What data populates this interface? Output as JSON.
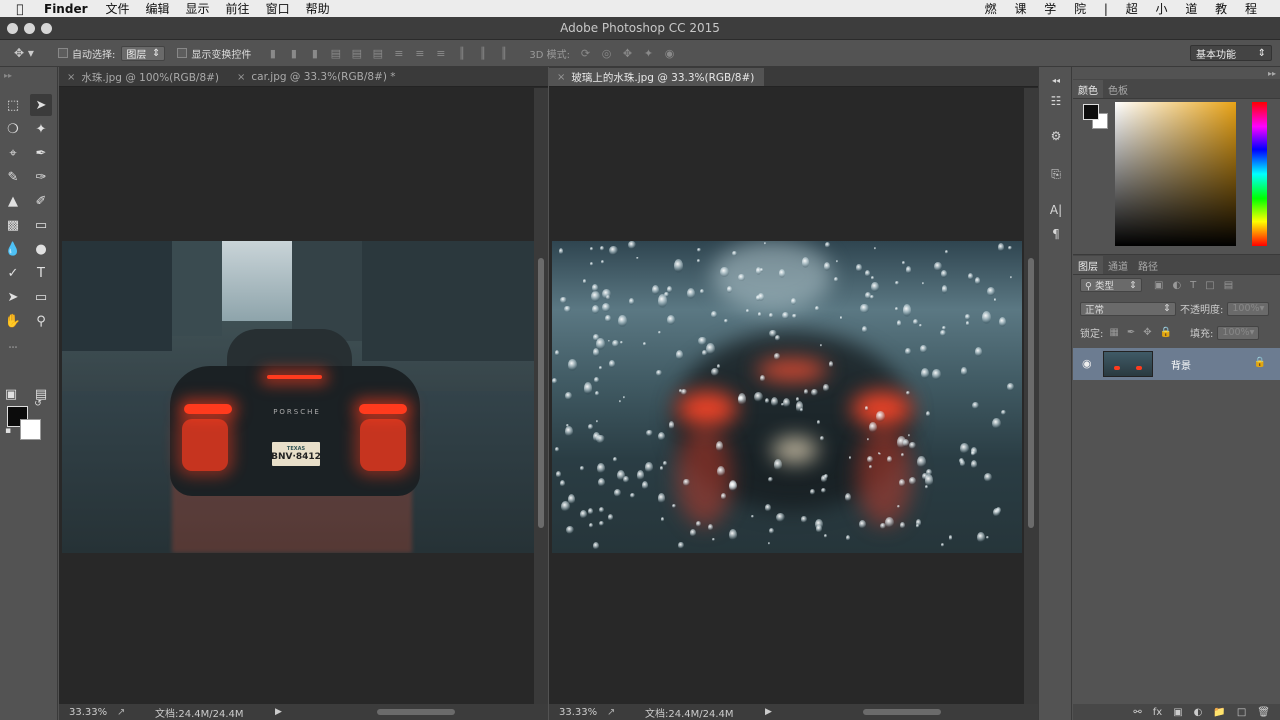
{
  "menubar": {
    "app": "Finder",
    "items": [
      "文件",
      "编辑",
      "显示",
      "前往",
      "窗口",
      "帮助"
    ],
    "watermark": "燃 课 学 院 | 超 小 道 教 程"
  },
  "window": {
    "title": "Adobe Photoshop CC 2015"
  },
  "options": {
    "auto_select_label": "自动选择:",
    "auto_select_value": "图层",
    "show_transform_label": "显示变换控件",
    "mode_3d_label": "3D 模式:",
    "workspace_value": "基本功能"
  },
  "left_pane": {
    "tabs": [
      {
        "label": "水珠.jpg @ 100%(RGB/8#)",
        "active": false
      },
      {
        "label": "car.jpg @ 33.3%(RGB/8#) *",
        "active": false
      }
    ],
    "plate_text": "BNV·8412",
    "plate_state": "TEXAS",
    "badge": "PORSCHE",
    "zoom": "33.33%",
    "doc_size": "文档:24.4M/24.4M"
  },
  "right_pane": {
    "tabs": [
      {
        "label": "玻璃上的水珠.jpg @ 33.3%(RGB/8#)",
        "active": true
      }
    ],
    "zoom": "33.33%",
    "doc_size": "文档:24.4M/24.4M"
  },
  "color_panel": {
    "tabs": [
      "颜色",
      "色板"
    ],
    "fg_color": "#0c0c0c",
    "bg_color": "#ffffff"
  },
  "layers_panel": {
    "tabs": [
      "图层",
      "通道",
      "路径"
    ],
    "filter_kind": "类型",
    "blend_mode": "正常",
    "opacity_label": "不透明度:",
    "opacity_value": "100%",
    "lock_label": "锁定:",
    "fill_label": "填充:",
    "fill_value": "100%",
    "layers": [
      {
        "name": "背景",
        "visible": true,
        "locked": true,
        "selected": true
      }
    ]
  }
}
